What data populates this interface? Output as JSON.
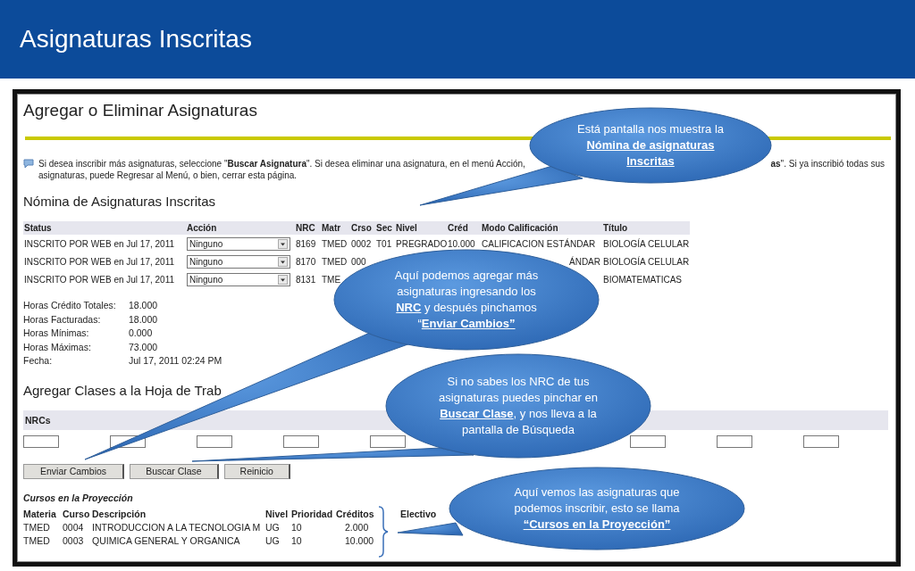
{
  "slide_title": "Asignaturas Inscritas",
  "page": {
    "title": "Agregar o Eliminar Asignaturas",
    "info_left": "Si desea inscribir más asignaturas, seleccione \"**Buscar Asignatura**\". Si desea eliminar una asignatura, en el menú Acción,",
    "info_right": "**as**\". Si ya inscribió todas sus",
    "info_line2": "asignaturas, puede Regresar al Menú, o bien, cerrar esta página.",
    "enrolled": {
      "heading": "Nómina de Asignaturas Inscritas",
      "columns": [
        {
          "label": "Status",
          "kind": "text"
        },
        {
          "label": "Acción",
          "kind": "dropdown"
        },
        {
          "label": "NRC",
          "kind": "text"
        },
        {
          "label": "Matr",
          "kind": "text"
        },
        {
          "label": "Crso",
          "kind": "text"
        },
        {
          "label": "Sec",
          "kind": "text"
        },
        {
          "label": "Nivel",
          "kind": "text"
        },
        {
          "label": "Créd",
          "kind": "text"
        },
        {
          "label": "Modo Calificación",
          "kind": "text"
        },
        {
          "label": "Título",
          "kind": "text"
        }
      ],
      "rows": [
        [
          "INSCRITO POR WEB en Jul 17, 2011",
          "Ninguno",
          "8169",
          "TMED",
          "0002",
          "T01",
          "PREGRADO",
          "10.000",
          "CALIFICACION ESTÁNDAR",
          "BIOLOGÍA CELULAR"
        ],
        [
          "INSCRITO POR WEB en Jul 17, 2011",
          "Ninguno",
          "8170",
          "TMED",
          "000",
          null,
          null,
          null,
          "ÁNDAR",
          "BIOLOGÍA CELULAR"
        ],
        [
          "INSCRITO POR WEB en Jul 17, 2011",
          "Ninguno",
          "8131",
          "TME",
          null,
          null,
          null,
          null,
          null,
          "BIOMATEMATICAS"
        ]
      ]
    },
    "totals": [
      {
        "label": "Horas Crédito Totales:",
        "value": "18.000"
      },
      {
        "label": "Horas Facturadas:",
        "value": "18.000"
      },
      {
        "label": "Horas Mínimas:",
        "value": "0.000"
      },
      {
        "label": "Horas Máximas:",
        "value": "73.000"
      },
      {
        "label": "Fecha:",
        "value": "Jul 17, 2011 02:24 PM"
      }
    ],
    "add_classes": {
      "heading": "Agregar Clases a la Hoja de Trab",
      "bar_label": "NRCs"
    },
    "buttons": [
      "Enviar Cambios",
      "Buscar Clase",
      "Reinicio"
    ],
    "projection": {
      "heading": "Cursos en la Proyección",
      "columns": [
        "Materia",
        "Curso",
        "Descripción",
        "Nivel",
        "Prioridad",
        "Créditos",
        "Electivo"
      ],
      "rows": [
        [
          "TMED",
          "0004",
          "INTRODUCCION A LA TECNOLOGIA M",
          "UG",
          "10",
          "2.000"
        ],
        [
          "TMED",
          "0003",
          "QUIMICA GENERAL Y ORGANICA",
          "UG",
          "10",
          "10.000"
        ]
      ]
    }
  },
  "callouts": [
    {
      "text": "Está pantalla nos muestra la **Nómina de asignaturas Inscritas**"
    },
    {
      "text": "Aquí podemos agregar más asignaturas  ingresando los **NRC**  y después pinchamos “**Enviar Cambios”**"
    },
    {
      "text": "Si no sabes los NRC de tus asignaturas puedes pinchar en **Buscar Clase**, y nos lleva a la pantalla de Búsqueda"
    },
    {
      "text": "Aquí vemos las asignaturas que podemos inscribir, esto se llama **“Cursos en la Proyección”**"
    }
  ]
}
